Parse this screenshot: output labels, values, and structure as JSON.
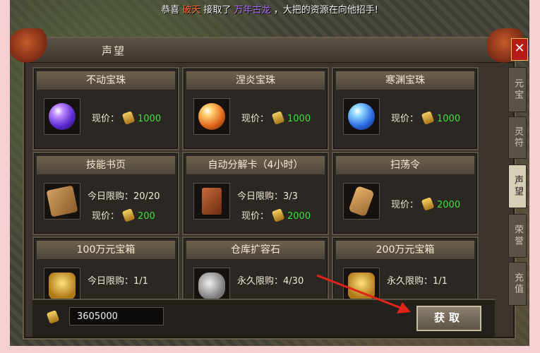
{
  "ticker": {
    "prefix": "恭喜",
    "player": "破天",
    "middle": "接取了",
    "monster": "万年古龙",
    "suffix": "，大把的资源在向他招手!"
  },
  "window": {
    "title": "声望",
    "close_label": "✕"
  },
  "cards": [
    {
      "name": "不动宝珠",
      "icon": "purple-orb",
      "price_label": "现价：",
      "price": "1000"
    },
    {
      "name": "涅炎宝珠",
      "icon": "orange-orb",
      "price_label": "现价：",
      "price": "1000"
    },
    {
      "name": "寒渊宝珠",
      "icon": "blue-orb",
      "price_label": "现价：",
      "price": "1000"
    },
    {
      "name": "技能书页",
      "icon": "book",
      "limit_label": "今日限购：",
      "limit": "20/20",
      "price_label": "现价：",
      "price": "200"
    },
    {
      "name": "自动分解卡（4小时）",
      "icon": "card",
      "limit_label": "今日限购：",
      "limit": "3/3",
      "price_label": "现价：",
      "price": "2000"
    },
    {
      "name": "扫荡令",
      "icon": "scroll",
      "price_label": "现价：",
      "price": "2000"
    },
    {
      "name": "100万元宝箱",
      "icon": "gold-chest",
      "limit_label": "今日限购：",
      "limit": "1/1"
    },
    {
      "name": "仓库扩容石",
      "icon": "stone",
      "limit_label": "永久限购：",
      "limit": "4/30"
    },
    {
      "name": "200万元宝箱",
      "icon": "gold-chest",
      "limit_label": "永久限购：",
      "limit": "1/1"
    }
  ],
  "side_tabs": [
    {
      "label": "元宝",
      "active": false
    },
    {
      "label": "灵符",
      "active": false
    },
    {
      "label": "声望",
      "active": true
    },
    {
      "label": "荣誉",
      "active": false
    },
    {
      "label": "充值",
      "active": false
    }
  ],
  "footer": {
    "currency_amount": "3605000",
    "obtain_button": "获取"
  },
  "colors": {
    "price_green": "#3ee03e",
    "close_red": "#b51a14",
    "arrow_red": "#e0241a"
  }
}
